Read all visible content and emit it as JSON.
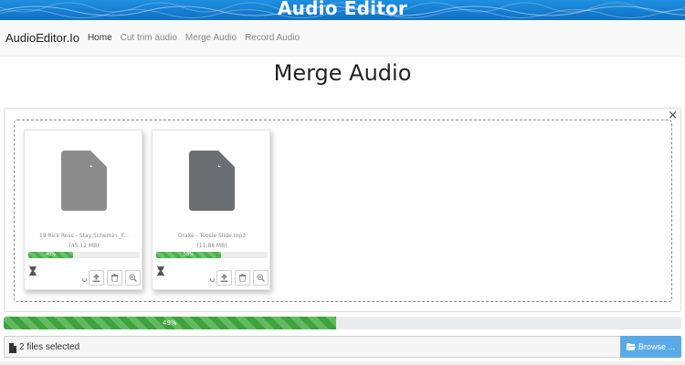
{
  "banner": {
    "title": "Audio Editor"
  },
  "nav": {
    "brand": "AudioEditor.Io",
    "links": [
      {
        "label": "Home"
      },
      {
        "label": "Cut trim audio"
      },
      {
        "label": "Merge Audio"
      },
      {
        "label": "Record Audio"
      }
    ]
  },
  "page": {
    "title": "Merge Audio"
  },
  "dropzone": {
    "close_label": "×"
  },
  "files": [
    {
      "name": "19 Rick Ross - Stay Schemin _F...",
      "size": "(45.12 MB)",
      "progress": 40,
      "progress_label": "40%"
    },
    {
      "name": "Drake - Toosie Slide.mp3",
      "size": "(11.88 MB)",
      "progress": 58,
      "progress_label": "58%"
    }
  ],
  "overall": {
    "progress": 49,
    "progress_label": "49%"
  },
  "footer": {
    "caption": "2 files selected",
    "browse_label": "Browse ..."
  },
  "icons": {
    "file": "file-icon",
    "upload": "upload-icon",
    "delete": "trash-icon",
    "zoom": "zoom-icon",
    "status": "hourglass-icon",
    "caption": "file-icon",
    "browse": "folder-open-icon"
  },
  "colors": {
    "banner": "#1174cc",
    "progress": "#4cae4c",
    "browse": "#5aaae6"
  }
}
